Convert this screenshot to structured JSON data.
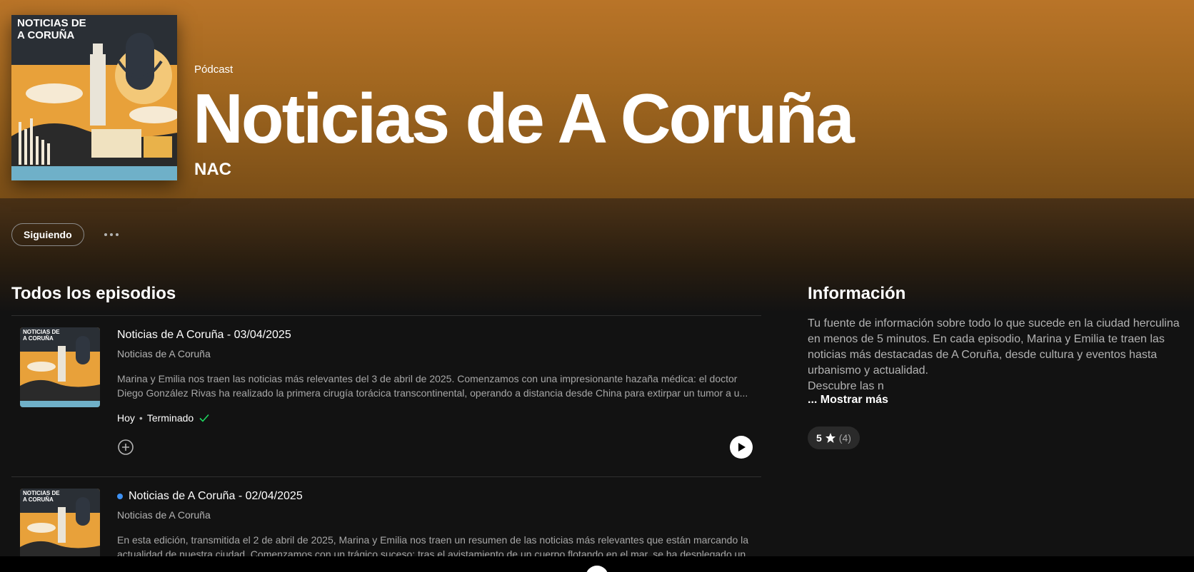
{
  "podcast": {
    "type_label": "Pódcast",
    "title": "Noticias de A Coruña",
    "author": "NAC",
    "cover_text_line1": "NOTICIAS DE",
    "cover_text_line2": "A CORUÑA"
  },
  "actions": {
    "follow_label": "Siguiendo",
    "more_icon": "more-options-icon"
  },
  "episodes_section": {
    "title": "Todos los episodios",
    "episodes": [
      {
        "title": "Noticias de A Coruña - 03/04/2025",
        "show": "Noticias de A Coruña",
        "description": "Marina y Emilia nos traen las noticias más relevantes del 3 de abril de 2025. Comenzamos con una impresionante hazaña médica: el doctor Diego González Rivas ha realizado la primera cirugía torácica transcontinental, operando a distancia desde China para extirpar un tumor a u...",
        "date": "Hoy",
        "status": "Terminado",
        "unplayed": false
      },
      {
        "title": "Noticias de A Coruña - 02/04/2025",
        "show": "Noticias de A Coruña",
        "description": "En esta edición, transmitida el 2 de abril de 2025, Marina y Emilia nos traen un resumen de las noticias más relevantes que están marcando la actualidad de nuestra ciudad. Comenzamos con un trágico suceso: tras el avistamiento de un cuerpo flotando en el mar, se ha desplegado un",
        "unplayed": true
      }
    ]
  },
  "info_section": {
    "title": "Información",
    "description": "Tu fuente de información sobre todo lo que sucede en la ciudad herculina en menos de 5 minutos. En cada episodio, Marina y Emilia te traen las noticias más destacadas de A Coruña, desde cultura y eventos hasta urbanismo y actualidad.",
    "description_more": "Descubre las n",
    "show_more": "... Mostrar más",
    "rating_value": "5",
    "rating_count": "(4)"
  },
  "colors": {
    "accent_green": "#1ed760",
    "unplayed_blue": "#3d91f4",
    "hero_orange": "#b97428"
  }
}
